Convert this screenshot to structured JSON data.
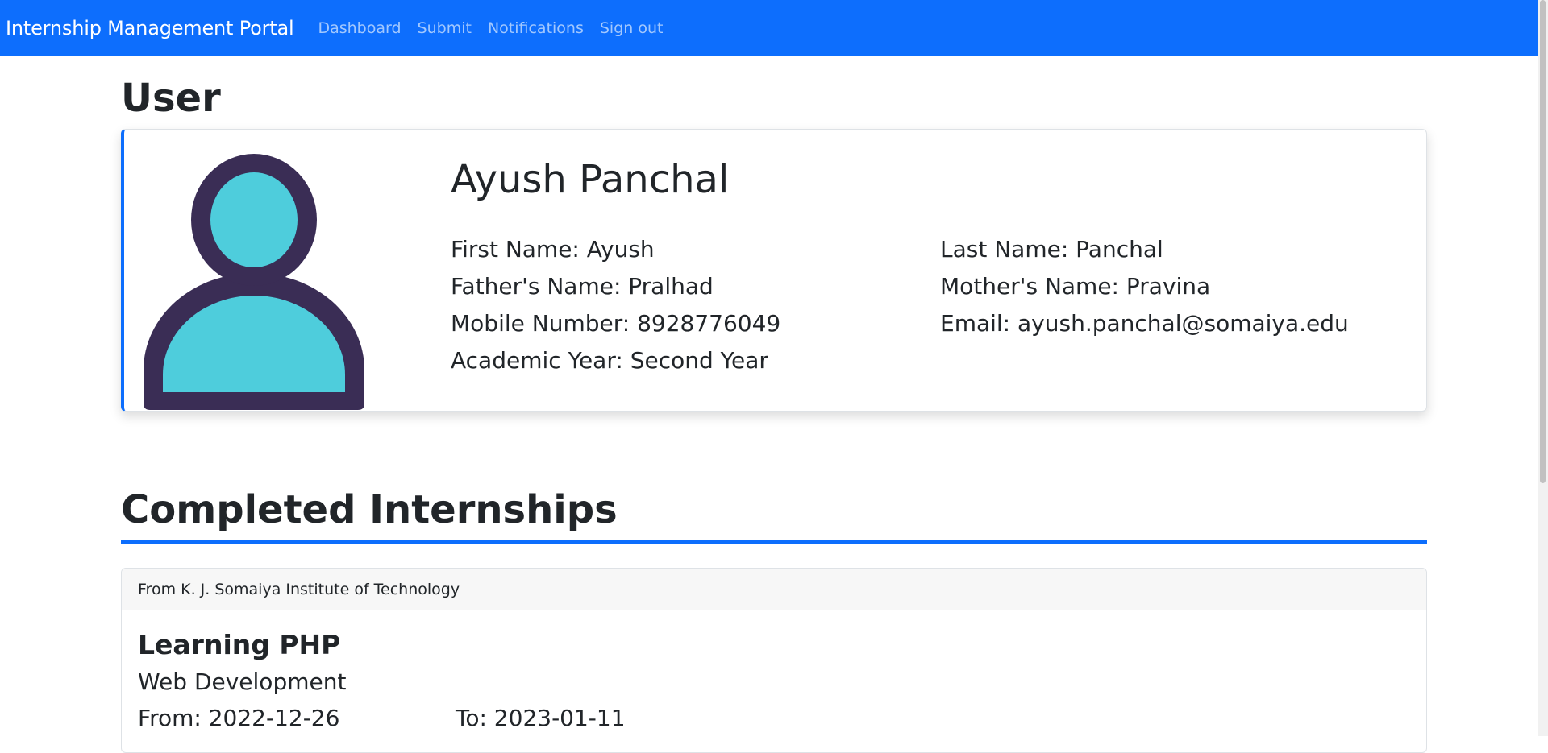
{
  "navbar": {
    "brand": "Internship Management Portal",
    "links": [
      {
        "label": "Dashboard"
      },
      {
        "label": "Submit"
      },
      {
        "label": "Notifications"
      },
      {
        "label": "Sign out"
      }
    ],
    "color": "#0d6efd"
  },
  "user_section": {
    "heading": "User",
    "avatar_icon": "person-icon",
    "name": "Ayush Panchal",
    "first_name": "First Name: Ayush",
    "last_name": "Last Name: Panchal",
    "father_name": "Father's Name: Pralhad",
    "mother_name": "Mother's Name: Pravina",
    "mobile": "Mobile Number: 8928776049",
    "email": "Email: ayush.panchal@somaiya.edu",
    "academic_year": "Academic Year: Second Year"
  },
  "completed": {
    "heading": "Completed Internships",
    "internships": [
      {
        "header": "From K. J. Somaiya Institute of Technology",
        "title": "Learning PHP",
        "field": "Web Development",
        "from": "From: 2022-12-26",
        "to": "To: 2023-01-11"
      }
    ]
  },
  "colors": {
    "accent": "#0d6efd",
    "avatar_fill": "#4ecddc",
    "avatar_outline": "#3a2d55"
  }
}
